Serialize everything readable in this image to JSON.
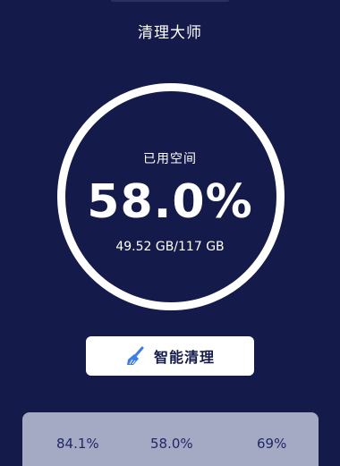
{
  "header": {
    "title": "清理大师"
  },
  "storage": {
    "label": "已用空间",
    "percent_text": "58.0%",
    "percent_value": 58.0,
    "used_text": "49.52 GB/117 GB"
  },
  "action": {
    "label": "智能清理",
    "icon": "broom-icon"
  },
  "stats": [
    {
      "value": "84.1%"
    },
    {
      "value": "58.0%"
    },
    {
      "value": "69%"
    }
  ],
  "colors": {
    "background": "#141b4a",
    "ring": "#ffffff",
    "button_bg": "#ffffff",
    "icon_blue": "#3d7cf0",
    "stats_card": "#a5aac4"
  }
}
